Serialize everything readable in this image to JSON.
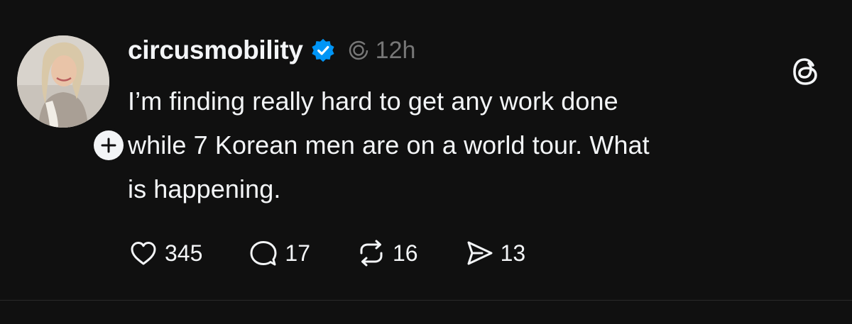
{
  "post": {
    "username": "circusmobility",
    "verified": true,
    "timestamp": "12h",
    "text_lines": [
      "I’m finding really hard to get any work done",
      "while 7 Korean men are on a world tour. What",
      "is happening."
    ],
    "actions": {
      "likes": "345",
      "replies": "17",
      "reposts": "16",
      "shares": "13"
    }
  },
  "icons": {
    "verified": "verified-badge-icon",
    "activity": "activity-ring-icon",
    "app_logo": "threads-logo-icon",
    "follow": "plus-icon",
    "like": "heart-icon",
    "reply": "comment-bubble-icon",
    "repost": "repost-arrows-icon",
    "share": "send-icon"
  },
  "colors": {
    "background": "#101010",
    "text": "#f3f5f7",
    "muted": "#777777",
    "verified_blue": "#0095f6"
  }
}
